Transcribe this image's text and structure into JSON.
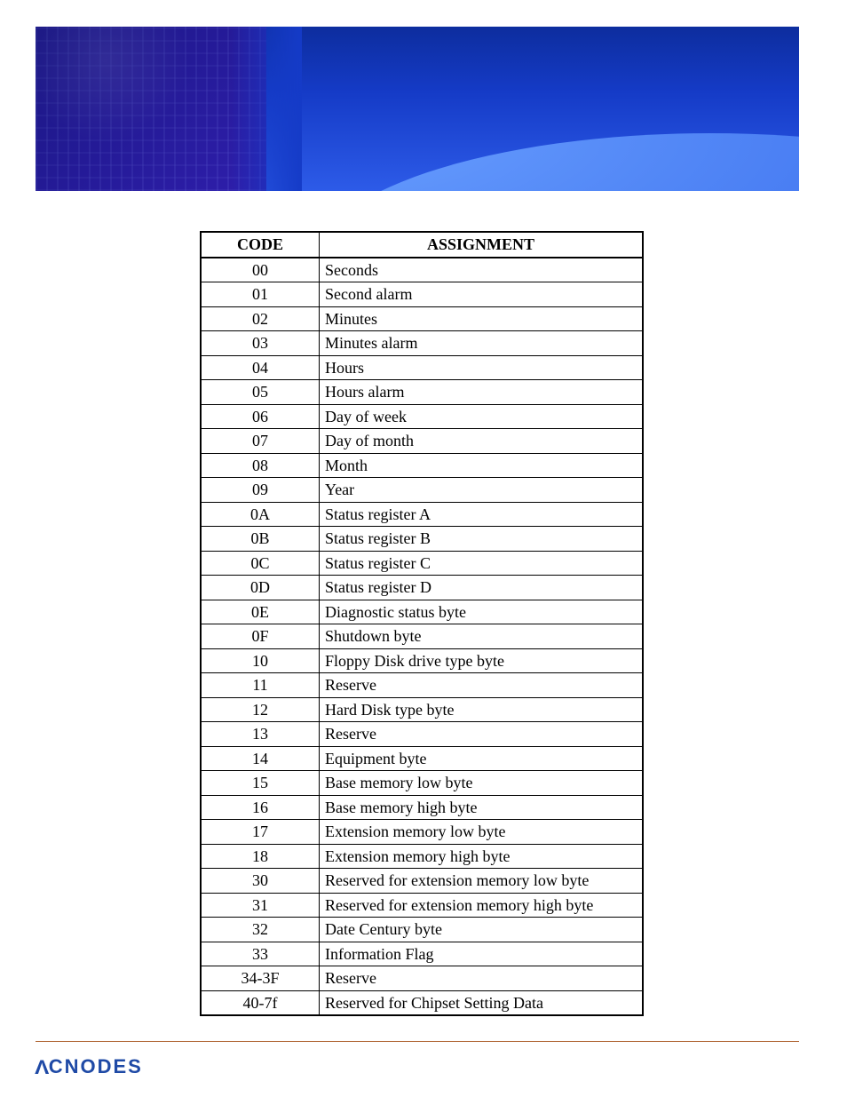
{
  "table": {
    "headers": {
      "code": "CODE",
      "assignment": "ASSIGNMENT"
    },
    "rows": [
      {
        "code": "00",
        "assignment": "Seconds"
      },
      {
        "code": "01",
        "assignment": "Second alarm"
      },
      {
        "code": "02",
        "assignment": "Minutes"
      },
      {
        "code": "03",
        "assignment": "Minutes alarm"
      },
      {
        "code": "04",
        "assignment": "Hours"
      },
      {
        "code": "05",
        "assignment": "Hours alarm"
      },
      {
        "code": "06",
        "assignment": "Day of week"
      },
      {
        "code": "07",
        "assignment": "Day of month"
      },
      {
        "code": "08",
        "assignment": "Month"
      },
      {
        "code": "09",
        "assignment": "Year"
      },
      {
        "code": "0A",
        "assignment": "Status register A"
      },
      {
        "code": "0B",
        "assignment": "Status register B"
      },
      {
        "code": "0C",
        "assignment": "Status register C"
      },
      {
        "code": "0D",
        "assignment": "Status register D"
      },
      {
        "code": "0E",
        "assignment": "Diagnostic status byte"
      },
      {
        "code": "0F",
        "assignment": "Shutdown byte"
      },
      {
        "code": "10",
        "assignment": "Floppy Disk  drive type byte"
      },
      {
        "code": "11",
        "assignment": "Reserve"
      },
      {
        "code": "12",
        "assignment": "Hard Disk type byte"
      },
      {
        "code": "13",
        "assignment": "Reserve"
      },
      {
        "code": "14",
        "assignment": "Equipment byte"
      },
      {
        "code": "15",
        "assignment": "Base memory low byte"
      },
      {
        "code": "16",
        "assignment": "Base memory high byte"
      },
      {
        "code": "17",
        "assignment": "Extension memory low byte"
      },
      {
        "code": "18",
        "assignment": "Extension memory high byte"
      },
      {
        "code": "30",
        "assignment": "Reserved for extension memory low byte"
      },
      {
        "code": "31",
        "assignment": "Reserved for extension memory high byte"
      },
      {
        "code": "32",
        "assignment": "Date Century byte"
      },
      {
        "code": "33",
        "assignment": "Information Flag"
      },
      {
        "code": "34-3F",
        "assignment": "Reserve"
      },
      {
        "code": "40-7f",
        "assignment": "Reserved for Chipset Setting Data"
      }
    ]
  },
  "brand": "CNODES"
}
